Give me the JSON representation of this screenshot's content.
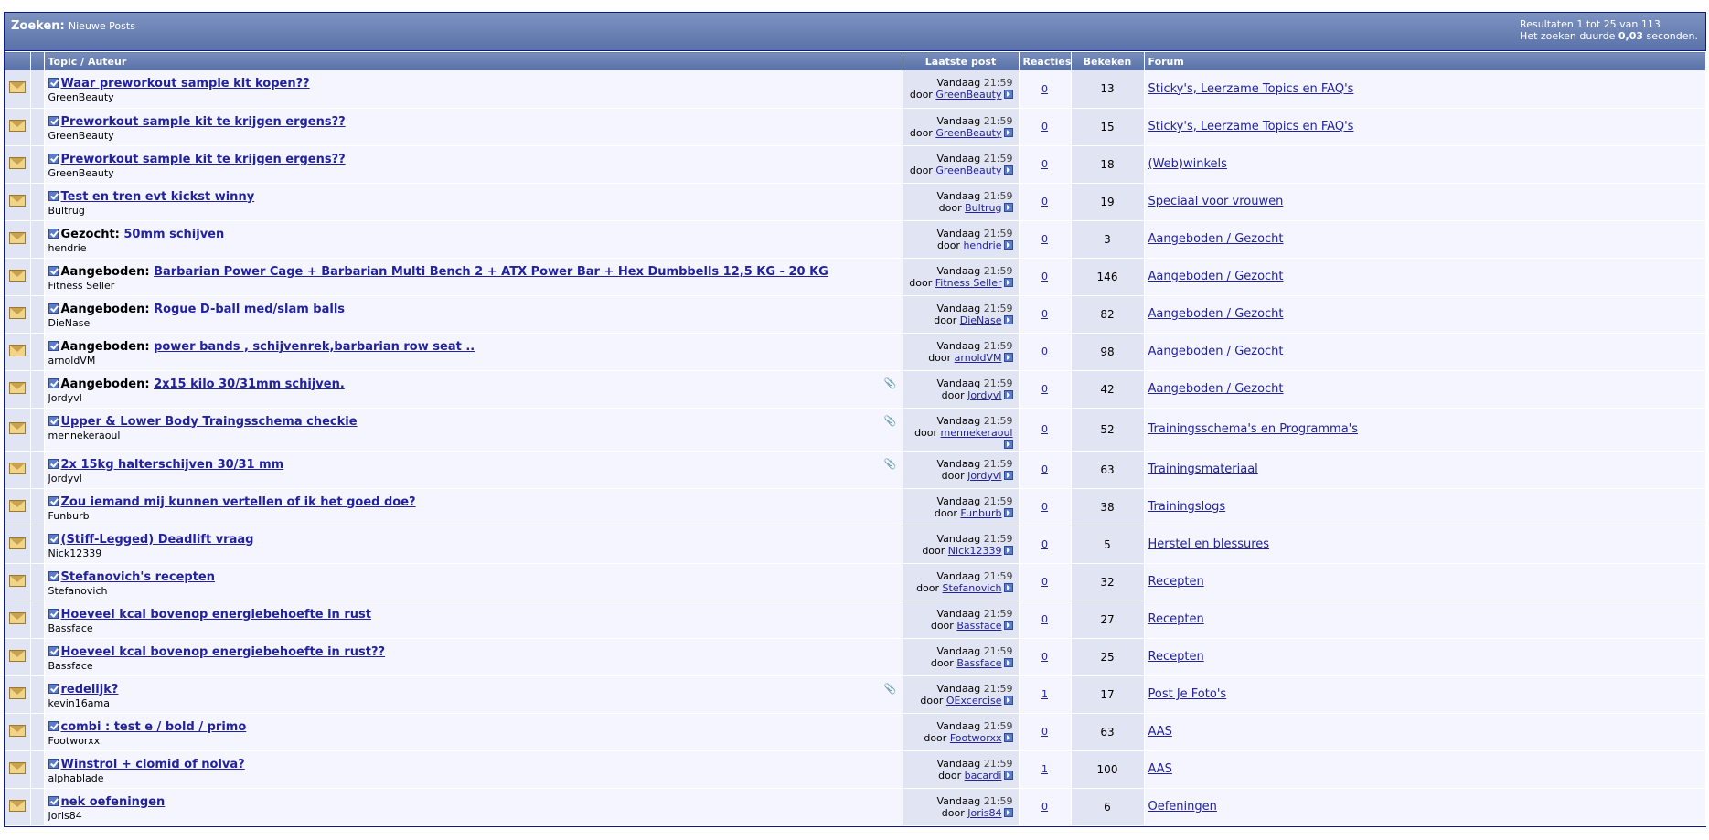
{
  "header": {
    "title": "Zoeken:",
    "subtitle": "Nieuwe Posts",
    "results": "Resultaten 1 tot 25 van 113",
    "search_time_prefix": "Het zoeken duurde",
    "search_time_value": "0,03",
    "search_time_suffix": "seconden."
  },
  "columns": {
    "topic": "Topic / Auteur",
    "last_post": "Laatste post",
    "replies": "Reacties",
    "views": "Bekeken",
    "forum": "Forum"
  },
  "rows": [
    {
      "prefix": "",
      "title": "Waar preworkout sample kit kopen??",
      "author": "GreenBeauty",
      "clip": false,
      "day": "Vandaag",
      "time": "21:59",
      "by": "door",
      "last_user": "GreenBeauty",
      "replies": "0",
      "views": "13",
      "forum": "Sticky's, Leerzame Topics en FAQ's"
    },
    {
      "prefix": "",
      "title": "Preworkout sample kit te krijgen ergens??",
      "author": "GreenBeauty",
      "clip": false,
      "day": "Vandaag",
      "time": "21:59",
      "by": "door",
      "last_user": "GreenBeauty",
      "replies": "0",
      "views": "15",
      "forum": "Sticky's, Leerzame Topics en FAQ's"
    },
    {
      "prefix": "",
      "title": "Preworkout sample kit te krijgen ergens??",
      "author": "GreenBeauty",
      "clip": false,
      "day": "Vandaag",
      "time": "21:59",
      "by": "door",
      "last_user": "GreenBeauty",
      "replies": "0",
      "views": "18",
      "forum": "(Web)winkels"
    },
    {
      "prefix": "",
      "title": "Test en tren evt kickst winny",
      "author": "Bultrug",
      "clip": false,
      "day": "Vandaag",
      "time": "21:59",
      "by": "door",
      "last_user": "Bultrug",
      "replies": "0",
      "views": "19",
      "forum": "Speciaal voor vrouwen"
    },
    {
      "prefix": "Gezocht:",
      "title": "50mm schijven",
      "author": "hendrie",
      "clip": false,
      "day": "Vandaag",
      "time": "21:59",
      "by": "door",
      "last_user": "hendrie",
      "replies": "0",
      "views": "3",
      "forum": "Aangeboden / Gezocht"
    },
    {
      "prefix": "Aangeboden:",
      "title": "Barbarian Power Cage + Barbarian Multi Bench 2 + ATX Power Bar + Hex Dumbbells 12,5 KG - 20 KG",
      "author": "Fitness Seller",
      "clip": false,
      "day": "Vandaag",
      "time": "21:59",
      "by": "door",
      "last_user": "Fitness Seller",
      "replies": "0",
      "views": "146",
      "forum": "Aangeboden / Gezocht"
    },
    {
      "prefix": "Aangeboden:",
      "title": "Rogue D-ball med/slam balls",
      "author": "DieNase",
      "clip": false,
      "day": "Vandaag",
      "time": "21:59",
      "by": "door",
      "last_user": "DieNase",
      "replies": "0",
      "views": "82",
      "forum": "Aangeboden / Gezocht"
    },
    {
      "prefix": "Aangeboden:",
      "title": "power bands , schijvenrek,barbarian row seat ..",
      "author": "arnoldVM",
      "clip": false,
      "day": "Vandaag",
      "time": "21:59",
      "by": "door",
      "last_user": "arnoldVM",
      "replies": "0",
      "views": "98",
      "forum": "Aangeboden / Gezocht"
    },
    {
      "prefix": "Aangeboden:",
      "title": "2x15 kilo 30/31mm schijven.",
      "author": "Jordyvl",
      "clip": true,
      "day": "Vandaag",
      "time": "21:59",
      "by": "door",
      "last_user": "Jordyvl",
      "replies": "0",
      "views": "42",
      "forum": "Aangeboden / Gezocht"
    },
    {
      "prefix": "",
      "title": "Upper & Lower Body Traingsschema checkie",
      "author": "mennekeraoul",
      "clip": true,
      "day": "Vandaag",
      "time": "21:59",
      "by": "door",
      "last_user": "mennekeraoul",
      "replies": "0",
      "views": "52",
      "forum": "Trainingsschema's en Programma's"
    },
    {
      "prefix": "",
      "title": "2x 15kg halterschijven 30/31 mm",
      "author": "Jordyvl",
      "clip": true,
      "day": "Vandaag",
      "time": "21:59",
      "by": "door",
      "last_user": "Jordyvl",
      "replies": "0",
      "views": "63",
      "forum": "Trainingsmateriaal"
    },
    {
      "prefix": "",
      "title": "Zou iemand mij kunnen vertellen of ik het goed doe?",
      "author": "Funburb",
      "clip": false,
      "day": "Vandaag",
      "time": "21:59",
      "by": "door",
      "last_user": "Funburb",
      "replies": "0",
      "views": "38",
      "forum": "Trainingslogs"
    },
    {
      "prefix": "",
      "title": "(Stiff-Legged) Deadlift vraag",
      "author": "Nick12339",
      "clip": false,
      "day": "Vandaag",
      "time": "21:59",
      "by": "door",
      "last_user": "Nick12339",
      "replies": "0",
      "views": "5",
      "forum": "Herstel en blessures"
    },
    {
      "prefix": "",
      "title": "Stefanovich's recepten",
      "author": "Stefanovich",
      "clip": false,
      "day": "Vandaag",
      "time": "21:59",
      "by": "door",
      "last_user": "Stefanovich",
      "replies": "0",
      "views": "32",
      "forum": "Recepten"
    },
    {
      "prefix": "",
      "title": "Hoeveel kcal bovenop energiebehoefte in rust",
      "author": "Bassface",
      "clip": false,
      "day": "Vandaag",
      "time": "21:59",
      "by": "door",
      "last_user": "Bassface",
      "replies": "0",
      "views": "27",
      "forum": "Recepten"
    },
    {
      "prefix": "",
      "title": "Hoeveel kcal bovenop energiebehoefte in rust??",
      "author": "Bassface",
      "clip": false,
      "day": "Vandaag",
      "time": "21:59",
      "by": "door",
      "last_user": "Bassface",
      "replies": "0",
      "views": "25",
      "forum": "Recepten"
    },
    {
      "prefix": "",
      "title": "redelijk?",
      "author": "kevin16ama",
      "clip": true,
      "day": "Vandaag",
      "time": "21:59",
      "by": "door",
      "last_user": "OExcercise",
      "replies": "1",
      "views": "17",
      "forum": "Post Je Foto's"
    },
    {
      "prefix": "",
      "title": "combi : test e / bold / primo",
      "author": "Footworxx",
      "clip": false,
      "day": "Vandaag",
      "time": "21:59",
      "by": "door",
      "last_user": "Footworxx",
      "replies": "0",
      "views": "63",
      "forum": "AAS"
    },
    {
      "prefix": "",
      "title": "Winstrol + clomid of nolva?",
      "author": "alphablade",
      "clip": false,
      "day": "Vandaag",
      "time": "21:59",
      "by": "door",
      "last_user": "bacardi",
      "replies": "1",
      "views": "100",
      "forum": "AAS"
    },
    {
      "prefix": "",
      "title": "nek oefeningen",
      "author": "Joris84",
      "clip": false,
      "day": "Vandaag",
      "time": "21:59",
      "by": "door",
      "last_user": "Joris84",
      "replies": "0",
      "views": "6",
      "forum": "Oefeningen"
    }
  ]
}
